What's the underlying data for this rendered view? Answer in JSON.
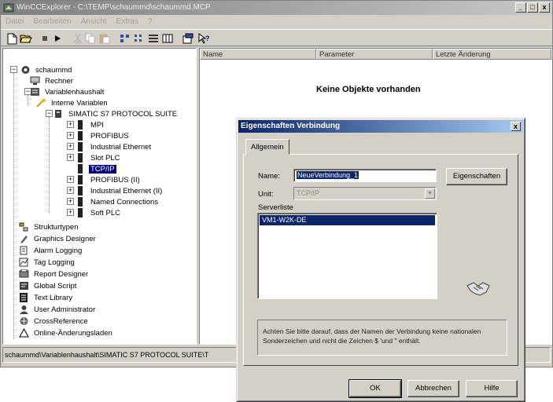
{
  "window": {
    "title": "WinCCExplorer - C:\\TEMP\\schaummd\\schaummd.MCP",
    "buttons": {
      "minimize": "_",
      "maximize": "□",
      "close": "x"
    }
  },
  "menubar": [
    "Datei",
    "Bearbeiten",
    "Ansicht",
    "Extras",
    "?"
  ],
  "toolbar": [
    "new-icon",
    "open-icon",
    "stop-icon",
    "run-icon",
    "cut-icon",
    "copy-icon",
    "paste-icon",
    "large-icons-icon",
    "small-icons-icon",
    "list-icon",
    "details-icon",
    "properties-icon",
    "help-icon"
  ],
  "tree": {
    "root": "schaummd",
    "items": [
      {
        "label": "Rechner",
        "icon": "computer-icon"
      },
      {
        "label": "Variablenhaushalt",
        "icon": "tag-management-icon"
      },
      {
        "label": "Interne Variablen",
        "icon": "internal-tags-icon"
      },
      {
        "label": "SIMATIC S7 PROTOCOL SUITE",
        "icon": "driver-icon"
      },
      {
        "label": "MPI",
        "icon": "channel-icon"
      },
      {
        "label": "PROFIBUS",
        "icon": "channel-icon"
      },
      {
        "label": "Industrial Ethernet",
        "icon": "channel-icon"
      },
      {
        "label": "Slot PLC",
        "icon": "channel-icon"
      },
      {
        "label": "TCP/IP",
        "icon": "channel-icon",
        "selected": true
      },
      {
        "label": "PROFIBUS (II)",
        "icon": "channel-icon"
      },
      {
        "label": "Industrial Ethernet (II)",
        "icon": "channel-icon"
      },
      {
        "label": "Named Connections",
        "icon": "channel-icon"
      },
      {
        "label": "Soft PLC",
        "icon": "channel-icon"
      },
      {
        "label": "Strukturtypen",
        "icon": "structure-icon"
      },
      {
        "label": "Graphics Designer",
        "icon": "graphics-designer-icon"
      },
      {
        "label": "Alarm Logging",
        "icon": "alarm-logging-icon"
      },
      {
        "label": "Tag Logging",
        "icon": "tag-logging-icon"
      },
      {
        "label": "Report Designer",
        "icon": "report-designer-icon"
      },
      {
        "label": "Global Script",
        "icon": "global-script-icon"
      },
      {
        "label": "Text Library",
        "icon": "text-library-icon"
      },
      {
        "label": "User Administrator",
        "icon": "user-admin-icon"
      },
      {
        "label": "CrossReference",
        "icon": "cross-reference-icon"
      },
      {
        "label": "Online-Änderungsladen",
        "icon": "online-change-icon"
      }
    ]
  },
  "list": {
    "columns": [
      "Name",
      "Parameter",
      "Letzte Änderung"
    ],
    "empty_message": "Keine Objekte vorhanden"
  },
  "statusbar": {
    "path": "schaummd\\Variablenhaushalt\\SIMATIC S7 PROTOCOL SUITE\\T"
  },
  "dialog": {
    "title": "Eigenschaften Verbindung",
    "close": "x",
    "tab": "Allgemein",
    "name_label": "Name:",
    "name_value": "NeueVerbindung_1",
    "unit_label": "Unit:",
    "unit_value": "TCP/IP",
    "properties_button": "Eigenschaften",
    "server_list_label": "Serverliste",
    "server_items": [
      "VM1-W2K-DE"
    ],
    "note": "Achten Sie bitte darauf, dass der Namen der Verbindung keine nationalen Sonderzeichen und nicht die Zeichen $ 'und \" enthält.",
    "ok_button": "OK",
    "cancel_button": "Abbrechen",
    "help_button": "Hilfe"
  }
}
